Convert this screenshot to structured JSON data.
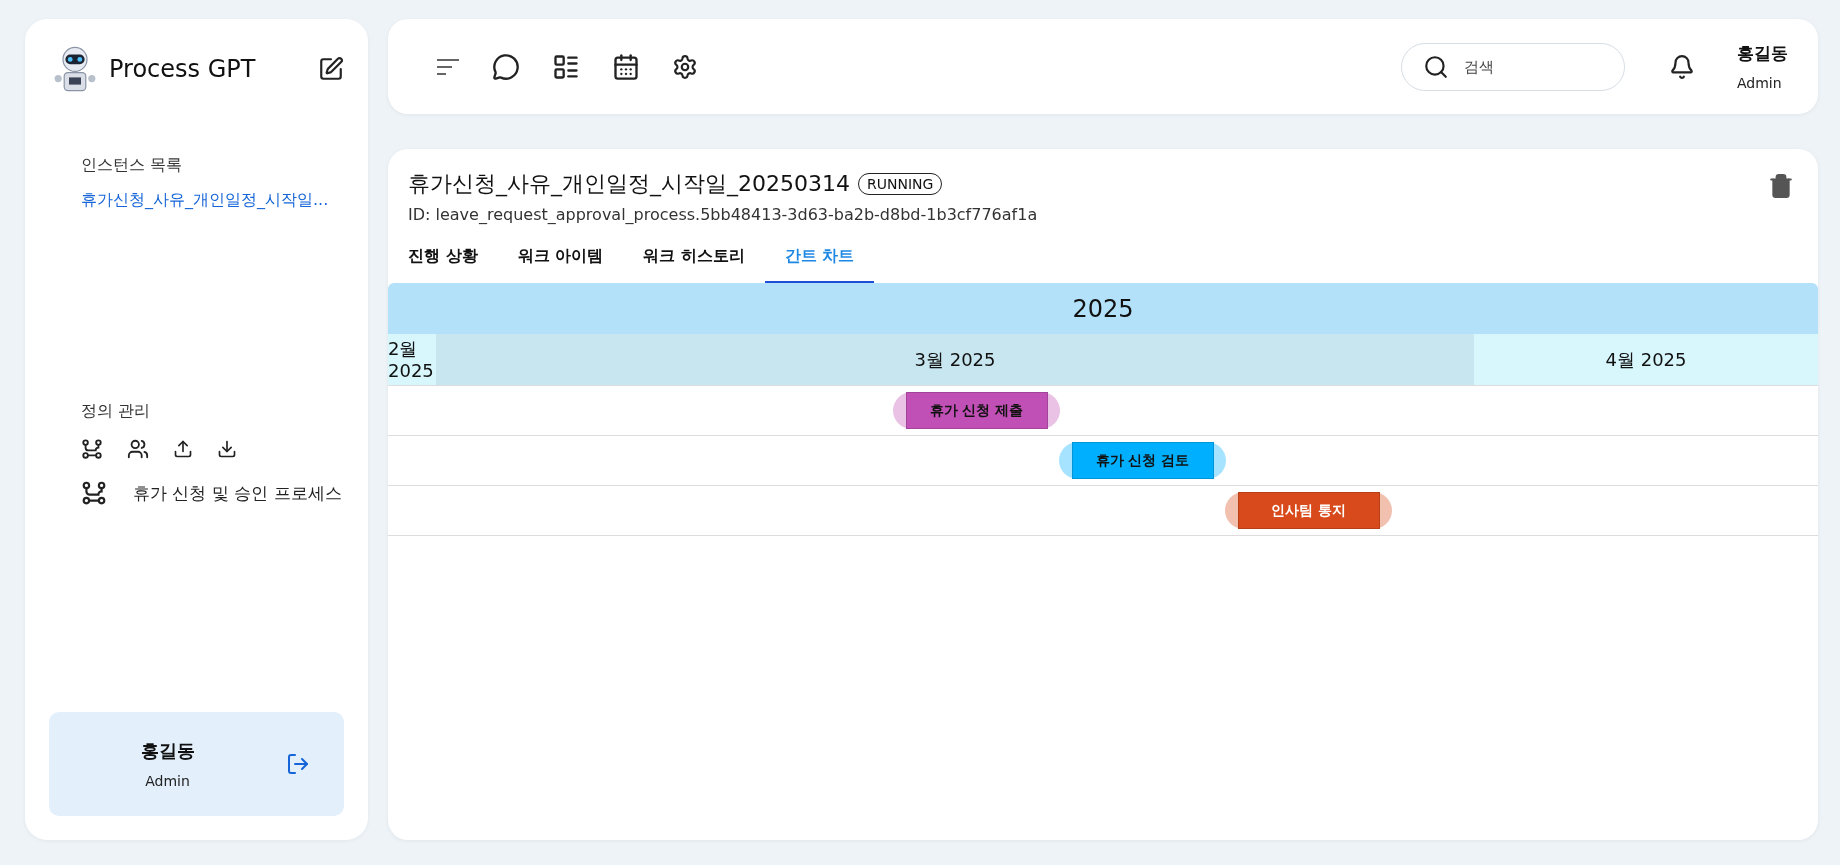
{
  "sidebar": {
    "app_name": "Process GPT",
    "instances_heading": "인스턴스 목록",
    "instances": [
      {
        "label": "휴가신청_사유_개인일정_시작일..."
      }
    ],
    "definitions_heading": "정의 관리",
    "definitions": [
      {
        "label": "휴가 신청 및 승인 프로세스"
      }
    ],
    "user": {
      "name": "홍길동",
      "role": "Admin"
    }
  },
  "topbar": {
    "search": {
      "placeholder": "검색"
    },
    "user": {
      "name": "홍길동",
      "role": "Admin"
    }
  },
  "instance": {
    "title": "휴가신청_사유_개인일정_시작일_20250314",
    "status": "RUNNING",
    "id": "ID: leave_request_approval_process.5bb48413-3d63-ba2b-d8bd-1b3cf776af1a",
    "tabs": [
      {
        "label": "진행 상황",
        "selected": false
      },
      {
        "label": "워크 아이템",
        "selected": false
      },
      {
        "label": "워크 히스토리",
        "selected": false
      },
      {
        "label": "간트 차트",
        "selected": true
      }
    ],
    "gantt": {
      "year": "2025",
      "months": [
        {
          "label": "2월 2025",
          "current": false
        },
        {
          "label": "3월 2025",
          "current": true
        },
        {
          "label": "4월 2025",
          "current": false
        }
      ],
      "tasks": [
        {
          "label": "휴가 신청 제출",
          "color": "#c050b5"
        },
        {
          "label": "휴가 신청 검토",
          "color": "#00b0ff"
        },
        {
          "label": "인사팀 통지",
          "color": "#d84a1b"
        }
      ]
    }
  }
}
